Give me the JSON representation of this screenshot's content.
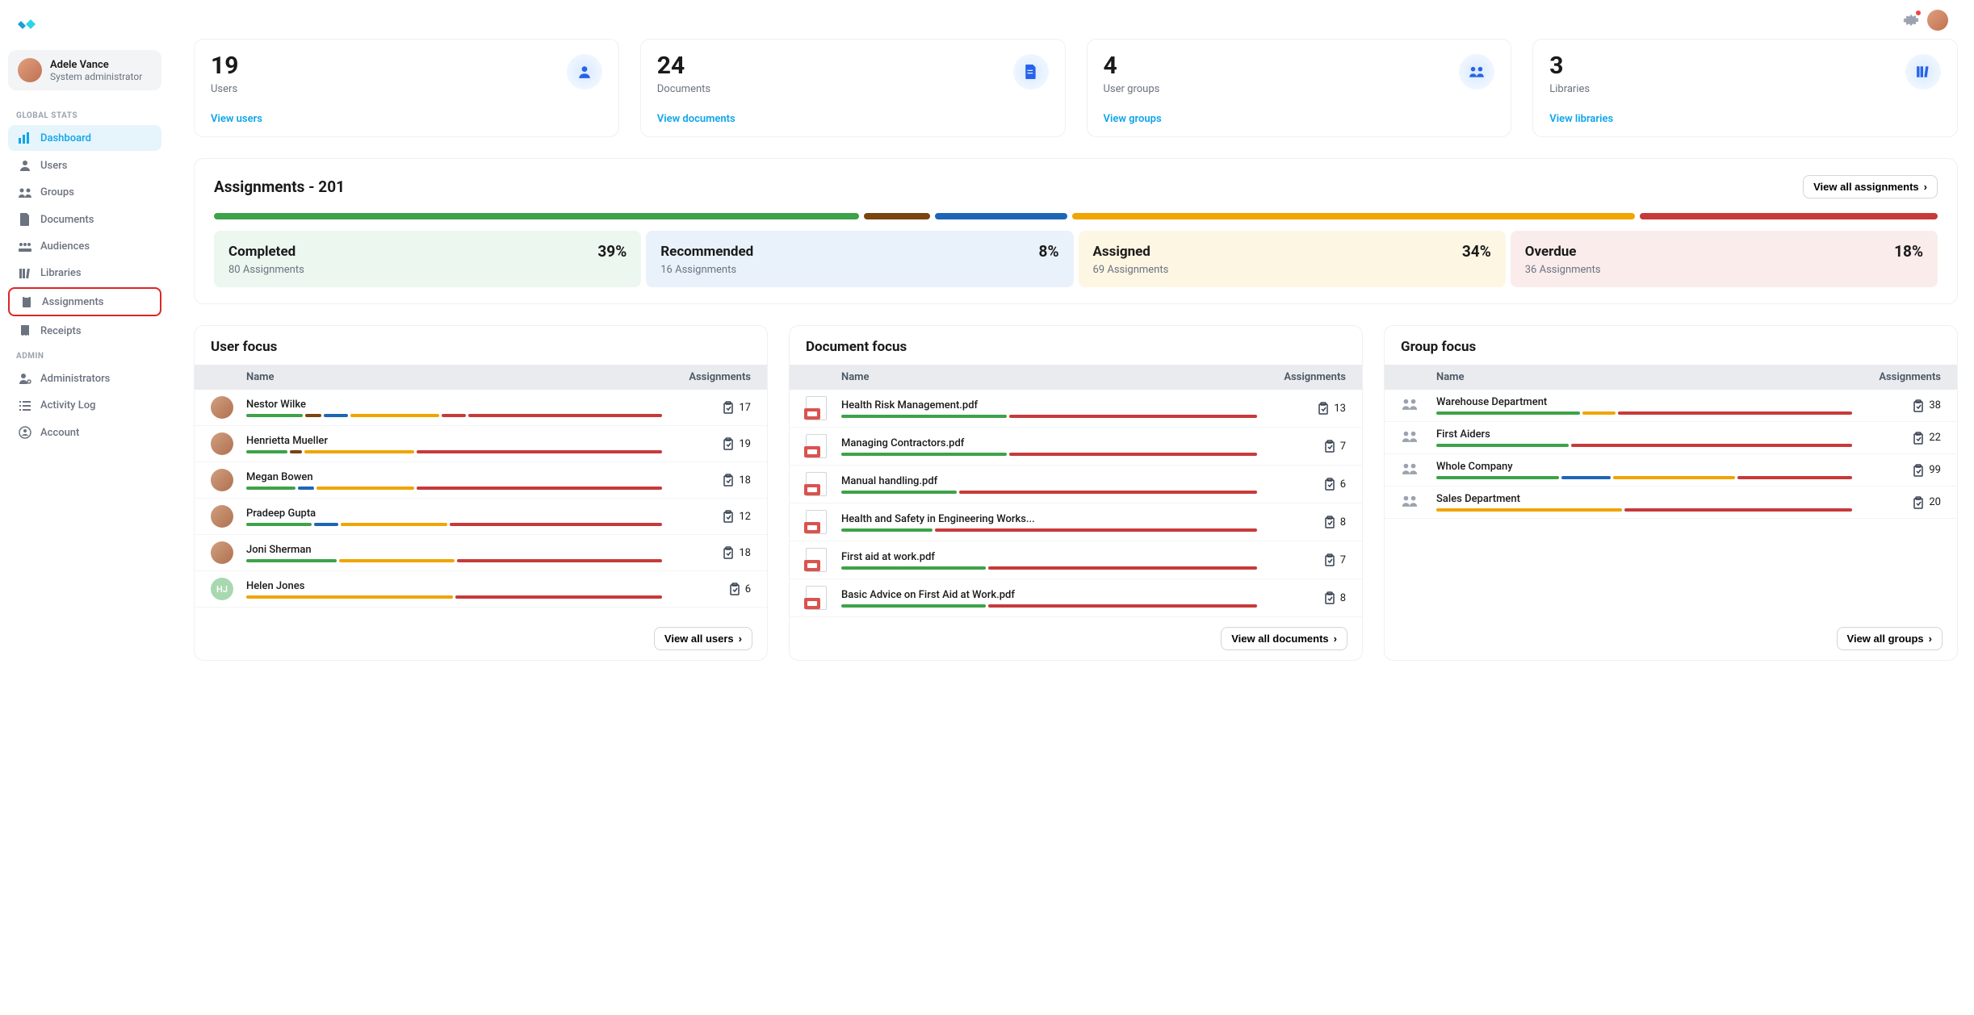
{
  "user": {
    "name": "Adele Vance",
    "role": "System administrator"
  },
  "nav": {
    "section1_label": "GLOBAL STATS",
    "section2_label": "ADMIN",
    "items": [
      {
        "label": "Dashboard"
      },
      {
        "label": "Users"
      },
      {
        "label": "Groups"
      },
      {
        "label": "Documents"
      },
      {
        "label": "Audiences"
      },
      {
        "label": "Libraries"
      },
      {
        "label": "Assignments"
      },
      {
        "label": "Receipts"
      },
      {
        "label": "Administrators"
      },
      {
        "label": "Activity Log"
      },
      {
        "label": "Account"
      }
    ]
  },
  "stats": [
    {
      "value": "19",
      "label": "Users",
      "link": "View users"
    },
    {
      "value": "24",
      "label": "Documents",
      "link": "View documents"
    },
    {
      "value": "4",
      "label": "User groups",
      "link": "View groups"
    },
    {
      "value": "3",
      "label": "Libraries",
      "link": "View libraries"
    }
  ],
  "assignments": {
    "title": "Assignments - 201",
    "view_all": "View all assignments",
    "segments": [
      {
        "pct": 39,
        "color": "seg-g"
      },
      {
        "pct": 4,
        "color": "seg-b"
      },
      {
        "pct": 8,
        "color": "seg-bl"
      },
      {
        "pct": 34,
        "color": "seg-y"
      },
      {
        "pct": 18,
        "color": "seg-r"
      }
    ],
    "cards": [
      {
        "title": "Completed",
        "pct": "39%",
        "sub": "80 Assignments",
        "cls": "completed"
      },
      {
        "title": "Recommended",
        "pct": "8%",
        "sub": "16 Assignments",
        "cls": "recommended"
      },
      {
        "title": "Assigned",
        "pct": "34%",
        "sub": "69 Assignments",
        "cls": "assigned"
      },
      {
        "title": "Overdue",
        "pct": "18%",
        "sub": "36 Assignments",
        "cls": "overdue"
      }
    ]
  },
  "focus": {
    "user": {
      "title": "User focus",
      "col_name": "Name",
      "col_assign": "Assignments",
      "footer": "View all users",
      "rows": [
        {
          "name": "Nestor Wilke",
          "count": "17",
          "bars": [
            [
              14,
              "seg-g"
            ],
            [
              4,
              "seg-b"
            ],
            [
              6,
              "seg-bl"
            ],
            [
              22,
              "seg-y"
            ],
            [
              6,
              "seg-r"
            ],
            [
              48,
              "seg-r"
            ]
          ]
        },
        {
          "name": "Henrietta Mueller",
          "count": "19",
          "bars": [
            [
              10,
              "seg-g"
            ],
            [
              3,
              "seg-b"
            ],
            [
              27,
              "seg-y"
            ],
            [
              60,
              "seg-r"
            ]
          ]
        },
        {
          "name": "Megan Bowen",
          "count": "18",
          "bars": [
            [
              12,
              "seg-g"
            ],
            [
              4,
              "seg-bl"
            ],
            [
              24,
              "seg-y"
            ],
            [
              60,
              "seg-r"
            ]
          ]
        },
        {
          "name": "Pradeep Gupta",
          "count": "12",
          "bars": [
            [
              16,
              "seg-g"
            ],
            [
              6,
              "seg-bl"
            ],
            [
              26,
              "seg-y"
            ],
            [
              52,
              "seg-r"
            ]
          ]
        },
        {
          "name": "Joni Sherman",
          "count": "18",
          "bars": [
            [
              22,
              "seg-g"
            ],
            [
              28,
              "seg-y"
            ],
            [
              50,
              "seg-r"
            ]
          ]
        },
        {
          "name": "Helen Jones",
          "count": "6",
          "initials": "HJ",
          "bars": [
            [
              50,
              "seg-y"
            ],
            [
              50,
              "seg-r"
            ]
          ]
        }
      ]
    },
    "doc": {
      "title": "Document focus",
      "col_name": "Name",
      "col_assign": "Assignments",
      "footer": "View all documents",
      "rows": [
        {
          "name": "Health Risk Management.pdf",
          "count": "13",
          "bars": [
            [
              40,
              "seg-g"
            ],
            [
              60,
              "seg-r"
            ]
          ]
        },
        {
          "name": "Managing Contractors.pdf",
          "count": "7",
          "bars": [
            [
              40,
              "seg-g"
            ],
            [
              60,
              "seg-r"
            ]
          ]
        },
        {
          "name": "Manual handling.pdf",
          "count": "6",
          "bars": [
            [
              28,
              "seg-g"
            ],
            [
              72,
              "seg-r"
            ]
          ]
        },
        {
          "name": "Health and Safety in Engineering Works...",
          "count": "8",
          "bars": [
            [
              22,
              "seg-g"
            ],
            [
              78,
              "seg-r"
            ]
          ]
        },
        {
          "name": "First aid at work.pdf",
          "count": "7",
          "bars": [
            [
              35,
              "seg-g"
            ],
            [
              65,
              "seg-r"
            ]
          ]
        },
        {
          "name": "Basic Advice on First Aid at Work.pdf",
          "count": "8",
          "bars": [
            [
              35,
              "seg-g"
            ],
            [
              65,
              "seg-r"
            ]
          ]
        }
      ]
    },
    "group": {
      "title": "Group focus",
      "col_name": "Name",
      "col_assign": "Assignments",
      "footer": "View all groups",
      "rows": [
        {
          "name": "Warehouse Department",
          "count": "38",
          "bars": [
            [
              35,
              "seg-g"
            ],
            [
              8,
              "seg-y"
            ],
            [
              57,
              "seg-r"
            ]
          ]
        },
        {
          "name": "First Aiders",
          "count": "22",
          "bars": [
            [
              32,
              "seg-g"
            ],
            [
              68,
              "seg-r"
            ]
          ]
        },
        {
          "name": "Whole Company",
          "count": "99",
          "bars": [
            [
              30,
              "seg-g"
            ],
            [
              12,
              "seg-bl"
            ],
            [
              30,
              "seg-y"
            ],
            [
              28,
              "seg-r"
            ]
          ]
        },
        {
          "name": "Sales Department",
          "count": "20",
          "bars": [
            [
              45,
              "seg-y"
            ],
            [
              55,
              "seg-r"
            ]
          ]
        }
      ]
    }
  }
}
